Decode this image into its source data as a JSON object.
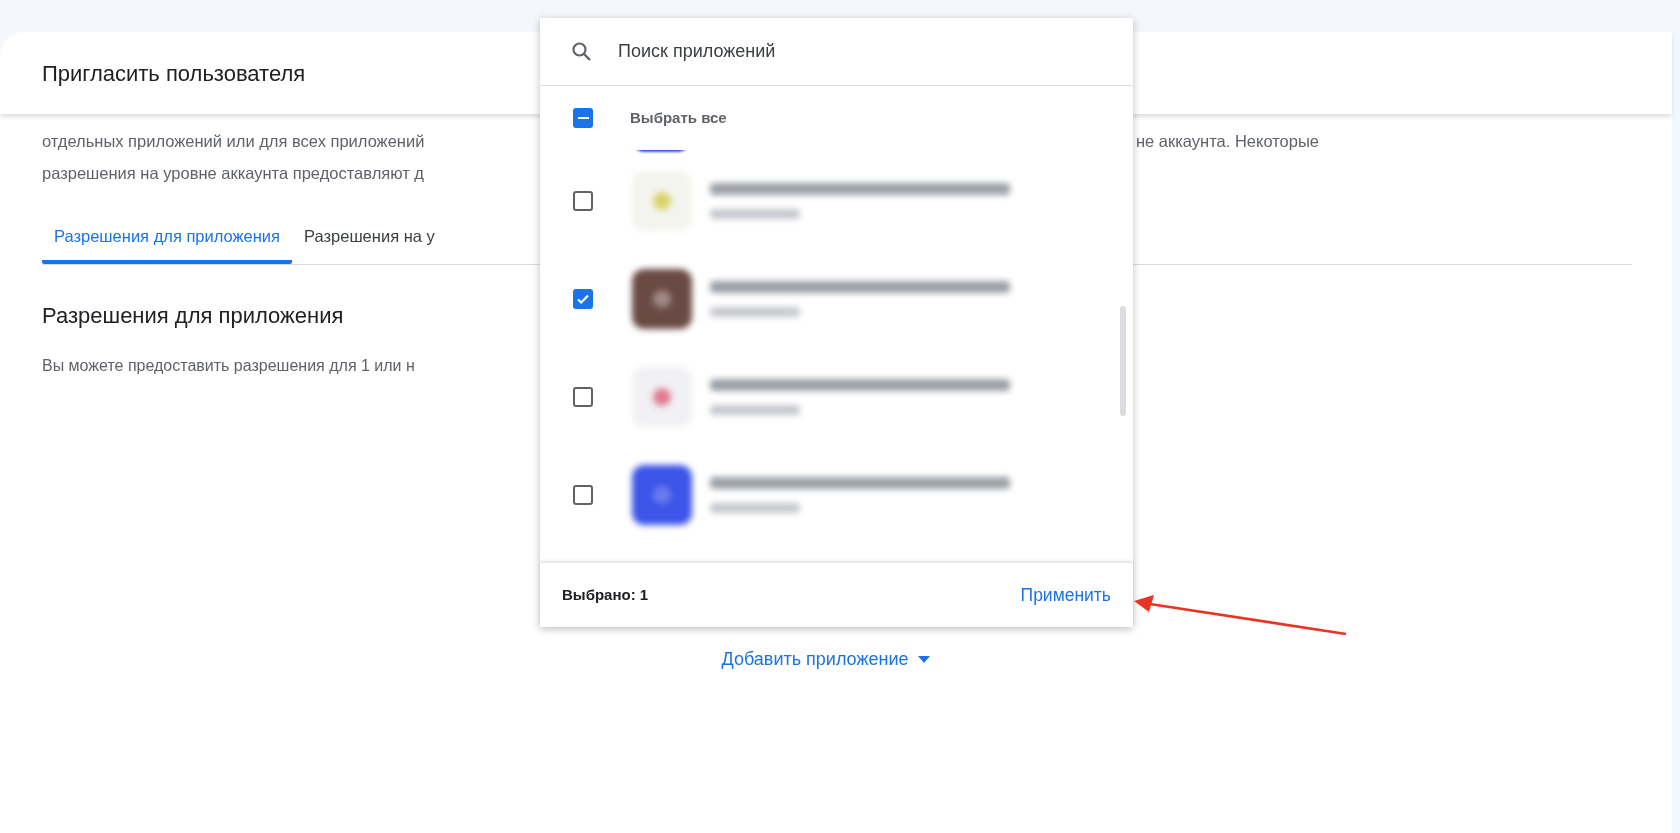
{
  "dialog": {
    "title": "Пригласить пользователя",
    "description_lines": [
      {
        "left": "отдельных приложений или для всех приложений",
        "right": "не аккаунта. Некоторые"
      },
      {
        "left": "разрешения на уровне аккаунта предоставляют д"
      }
    ],
    "tabs": [
      {
        "label": "Разрешения для приложения",
        "selected": true
      },
      {
        "label": "Разрешения на у",
        "selected": false
      }
    ],
    "section_title": "Разрешения для приложения",
    "section_text": "Вы можете предоставить разрешения для 1 или н",
    "add_app": "Добавить приложение"
  },
  "app_picker": {
    "search": {
      "placeholder": "Поиск приложений"
    },
    "select_all": {
      "label": "Выбрать все",
      "indeterminate": true
    },
    "apps": [
      {
        "checked": false
      },
      {
        "checked": true
      },
      {
        "checked": false
      },
      {
        "checked": false
      }
    ],
    "selected_count": "Выбрано: 1",
    "apply": "Применить"
  }
}
